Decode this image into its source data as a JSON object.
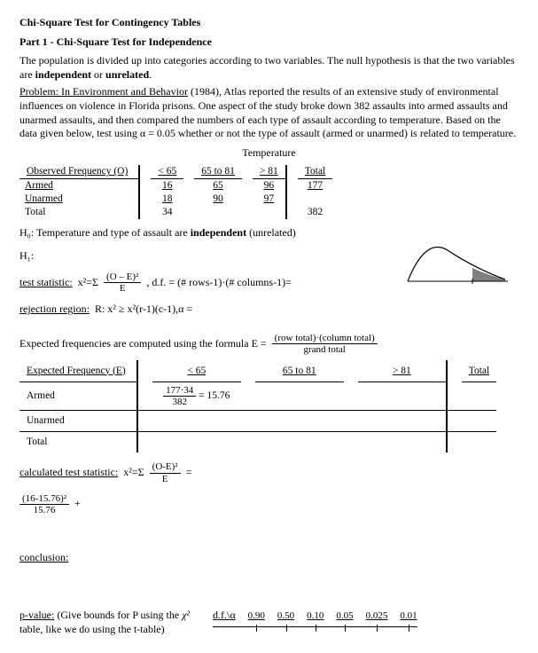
{
  "title": "Chi-Square Test for Contingency Tables",
  "part": "Part 1 - Chi-Square Test for Independence",
  "intro": "The population is divided up into categories according to two variables. The null hypothesis is that the two variables are ",
  "intro_bold1": "independent",
  "intro_mid": " or ",
  "intro_bold2": "unrelated",
  "intro_end": ".",
  "problem_label": "Problem:",
  "problem_src": " In Environment and Behavior",
  "problem_text": " (1984), Atlas reported the results of an extensive study of environmental influences on violence in Florida prisons. One aspect of the study broke down 382 assaults into armed assaults and unarmed assaults, and then compared the numbers of each type of assault according to temperature. Based on the data given below, test using α = 0.05 whether or not the type of assault (armed or unarmed) is related to temperature.",
  "temp_label": "Temperature",
  "obs_header": "Observed Frequency (O)",
  "cols": {
    "c1": "< 65",
    "c2": "65 to 81",
    "c3": "> 81",
    "total": "Total"
  },
  "rows": {
    "armed": "Armed",
    "unarmed": "Unarmed",
    "total": "Total"
  },
  "obs": {
    "armed": {
      "c1": "16",
      "c2": "65",
      "c3": "96",
      "total": "177"
    },
    "unarmed": {
      "c1": "18",
      "c2": "90",
      "c3": "97",
      "total": ""
    },
    "total": {
      "c1": "34",
      "c2": "",
      "c3": "",
      "total": "382"
    }
  },
  "h0_label": "H₀:",
  "h0_text": " Temperature and type of assault are ",
  "h0_bold": "independent",
  "h0_end": " (unrelated)",
  "h1_label": "H₁:",
  "test_stat_label": "test statistic:",
  "test_stat_formula_pre": " x²=Σ",
  "test_stat_num": "(O – E)²",
  "test_stat_den": "E",
  "df_text": ",   d.f. = (# rows-1)·(# columns-1)=",
  "rej_label": "rejection region:",
  "rej_text": " R: x² ≥ x²(r-1)(c-1),α =",
  "exp_formula_text": "Expected frequencies are computed using the formula E = ",
  "exp_formula_num": "(row total)·(column total)",
  "exp_formula_den": "grand total",
  "exp_header": "Expected Frequency (E)",
  "exp_armed_c1_num": "177·34",
  "exp_armed_c1_den": "382",
  "exp_armed_c1_val": " = 15.76",
  "calc_label": "calculated test statistic:",
  "calc_formula_pre": " x²=Σ",
  "calc_num": "(O-E)²",
  "calc_den": "E",
  "calc_eq": "  =",
  "calc_term_num": "(16-15.76)²",
  "calc_term_den": "15.76",
  "calc_plus": "  +",
  "conclusion_label": "conclusion:",
  "pvalue_label": "p-value:",
  "pvalue_text": " (Give bounds for P using the ",
  "pvalue_text2": " table, like we do using the t-table)",
  "df_alpha": "d.f.\\α",
  "pvals": [
    "0.90",
    "0.50",
    "0.10",
    "0.05",
    "0.025",
    "0.01"
  ]
}
